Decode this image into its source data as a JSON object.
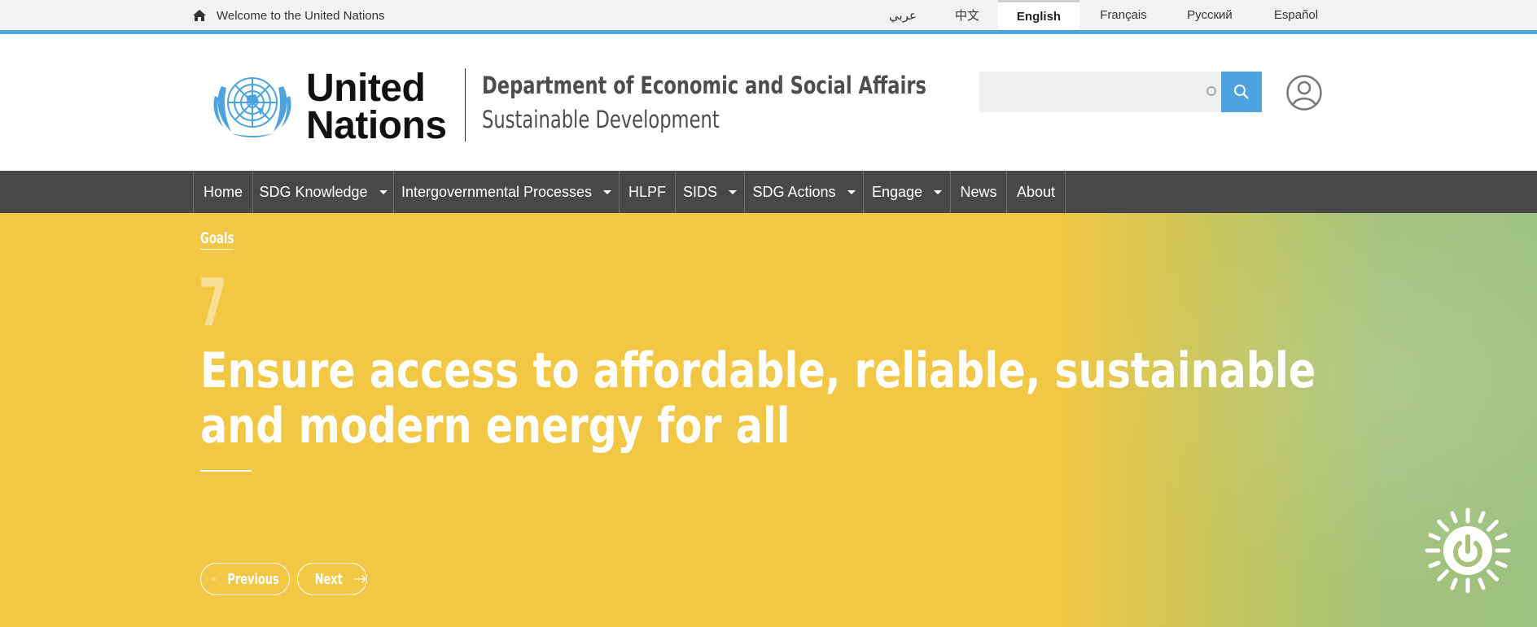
{
  "topbar": {
    "welcome_text": "Welcome to the United Nations",
    "languages": [
      {
        "label": "عربي",
        "active": false
      },
      {
        "label": "中文",
        "active": false
      },
      {
        "label": "English",
        "active": true
      },
      {
        "label": "Français",
        "active": false
      },
      {
        "label": "Русский",
        "active": false
      },
      {
        "label": "Español",
        "active": false
      }
    ]
  },
  "header": {
    "logo_line1": "United",
    "logo_line2": "Nations",
    "department": "Department of Economic and Social Affairs",
    "subtitle": "Sustainable Development",
    "search_placeholder": ""
  },
  "nav": {
    "items": [
      {
        "label": "Home",
        "dropdown": false
      },
      {
        "label": "SDG Knowledge",
        "dropdown": true
      },
      {
        "label": "Intergovernmental Processes",
        "dropdown": true
      },
      {
        "label": "HLPF",
        "dropdown": false
      },
      {
        "label": "SIDS",
        "dropdown": true
      },
      {
        "label": "SDG Actions",
        "dropdown": true
      },
      {
        "label": "Engage",
        "dropdown": true
      },
      {
        "label": "News",
        "dropdown": false
      },
      {
        "label": "About",
        "dropdown": false
      }
    ]
  },
  "hero": {
    "breadcrumb": "Goals",
    "goal_number": "7",
    "title_line1": "Ensure access to affordable, reliable, sustainable",
    "title_line2": "and modern energy for all",
    "previous_label": "Previous",
    "next_label": "Next",
    "accent_color": "#f2c744",
    "icon": "sun-power-icon"
  },
  "colors": {
    "topbar_accent": "#4ca3dd",
    "nav_bg": "#484848",
    "search_button": "#4ca3dd"
  }
}
